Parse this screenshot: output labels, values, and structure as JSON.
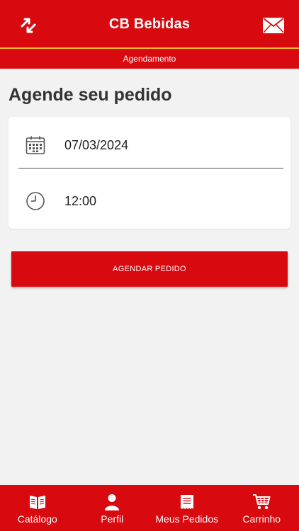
{
  "header": {
    "title": "CB Bebidas",
    "left_icon": "refresh-arrows-icon",
    "right_icon": "envelope-icon"
  },
  "subheader": {
    "label": "Agendamento"
  },
  "page": {
    "title": "Agende seu pedido"
  },
  "schedule": {
    "date_icon": "calendar-icon",
    "date_value": "07/03/2024",
    "time_icon": "clock-icon",
    "time_value": "12:00"
  },
  "actions": {
    "schedule_button": "AGENDAR PEDIDO"
  },
  "bottom_nav": {
    "items": [
      {
        "label": "Catálogo",
        "icon": "book-icon"
      },
      {
        "label": "Perfil",
        "icon": "user-icon"
      },
      {
        "label": "Meus Pedidos",
        "icon": "receipt-icon"
      },
      {
        "label": "Carrinho",
        "icon": "cart-icon"
      }
    ]
  },
  "colors": {
    "brand_red": "#d8090f",
    "accent_yellow": "#f3b821",
    "background": "#f2f2f2"
  }
}
